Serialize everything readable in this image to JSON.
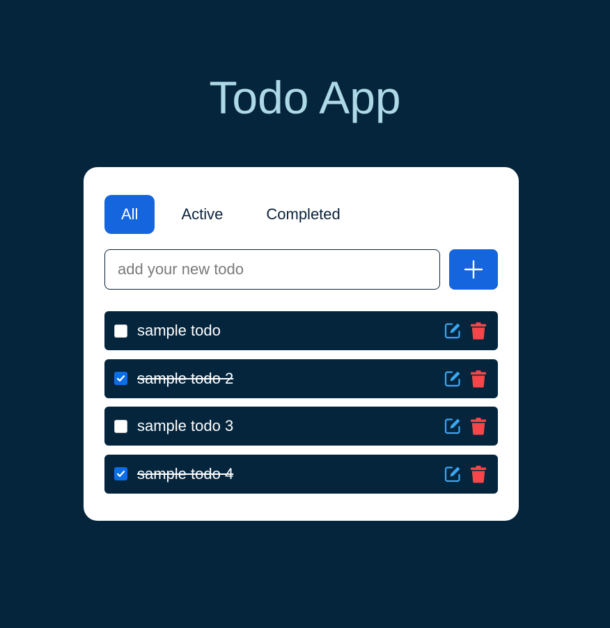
{
  "app": {
    "title": "Todo App"
  },
  "filters": [
    {
      "label": "All",
      "active": true
    },
    {
      "label": "Active",
      "active": false
    },
    {
      "label": "Completed",
      "active": false
    }
  ],
  "new_todo": {
    "placeholder": "add your new todo",
    "value": "",
    "add_icon": "plus-icon"
  },
  "todos": [
    {
      "text": "sample todo",
      "completed": false
    },
    {
      "text": "sample todo 2",
      "completed": true
    },
    {
      "text": "sample todo 3",
      "completed": false
    },
    {
      "text": "sample todo 4",
      "completed": true
    }
  ],
  "icons": {
    "edit": "edit-icon",
    "delete": "trash-icon"
  },
  "colors": {
    "background": "#05253c",
    "card": "#ffffff",
    "title": "#add8e6",
    "accent": "#1565de",
    "edit_icon": "#3aa8f5",
    "delete_icon": "#f4474a"
  }
}
